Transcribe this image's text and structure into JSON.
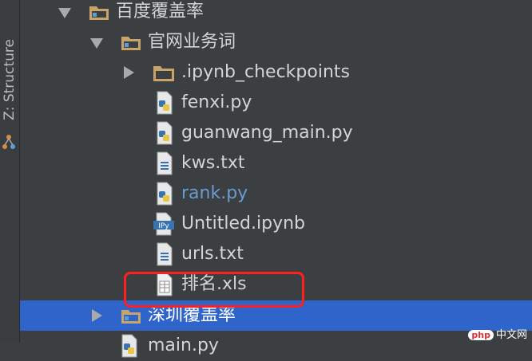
{
  "sidebar": {
    "structure_label": "Z: Structure"
  },
  "tree": {
    "rows": [
      {
        "label": "百度覆盖率",
        "type": "folder",
        "expanded": true
      },
      {
        "label": "官网业务词",
        "type": "folder",
        "expanded": true
      },
      {
        "label": ".ipynb_checkpoints",
        "type": "folder",
        "expanded": false
      },
      {
        "label": "fenxi.py",
        "type": "python"
      },
      {
        "label": "guanwang_main.py",
        "type": "python"
      },
      {
        "label": "kws.txt",
        "type": "text"
      },
      {
        "label": "rank.py",
        "type": "python",
        "modified": true
      },
      {
        "label": "Untitled.ipynb",
        "type": "notebook"
      },
      {
        "label": "urls.txt",
        "type": "text"
      },
      {
        "label": "排名.xls",
        "type": "spreadsheet",
        "highlighted": true
      },
      {
        "label": "深圳覆盖率",
        "type": "folder",
        "expanded": false,
        "selected": true
      },
      {
        "label": "main.py",
        "type": "python"
      }
    ]
  },
  "watermark": {
    "badge": "php",
    "text": "中文网"
  },
  "colors": {
    "background": "#3c3f41",
    "selection": "#2f65ca",
    "highlight_border": "#ff1f1f",
    "modified_file": "#6a9ccf"
  }
}
